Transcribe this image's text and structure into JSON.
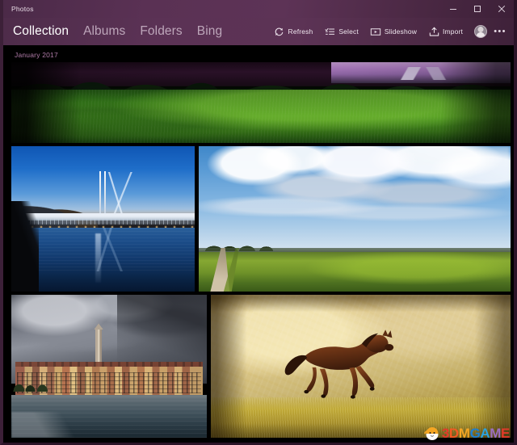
{
  "window": {
    "title": "Photos",
    "controls": [
      {
        "name": "minimize",
        "glyph": "–"
      },
      {
        "name": "maximize",
        "glyph": "□"
      },
      {
        "name": "close",
        "glyph": "✕"
      }
    ]
  },
  "nav": {
    "tabs": [
      {
        "label": "Collection",
        "active": true
      },
      {
        "label": "Albums",
        "active": false
      },
      {
        "label": "Folders",
        "active": false
      },
      {
        "label": "Bing",
        "active": false
      }
    ]
  },
  "commands": {
    "refresh": {
      "label": "Refresh",
      "icon": "refresh-icon"
    },
    "select": {
      "label": "Select",
      "icon": "select-list-icon"
    },
    "slideshow": {
      "label": "Slideshow",
      "icon": "slideshow-icon"
    },
    "import": {
      "label": "Import",
      "icon": "import-icon"
    },
    "account": {
      "icon": "account-avatar-icon"
    },
    "overflow": {
      "label": "•••",
      "icon": "ellipsis-icon"
    }
  },
  "gallery": {
    "date_header": "January 2017",
    "photos": [
      {
        "id": "photo-meadow",
        "caption": "Green meadow with treeline at purple dusk"
      },
      {
        "id": "photo-bridge",
        "caption": "Suspension bridge reflected in still water"
      },
      {
        "id": "photo-field",
        "caption": "Dirt road beside open field under cumulus clouds"
      },
      {
        "id": "photo-town",
        "caption": "Coastal old town with bell tower under storm clouds"
      },
      {
        "id": "photo-horse",
        "caption": "Galloping bay horse in golden field"
      }
    ]
  },
  "watermark": {
    "letters": [
      "3",
      "D",
      "M",
      "G",
      "A",
      "M",
      "E"
    ],
    "text": "3DMGAME"
  },
  "colors": {
    "titlebar_accent": "#5b3255",
    "date_accent": "#b07ba8",
    "tab_active": "#ffffff",
    "tab_inactive": "#bda6ba",
    "content_bg": "#000000"
  }
}
